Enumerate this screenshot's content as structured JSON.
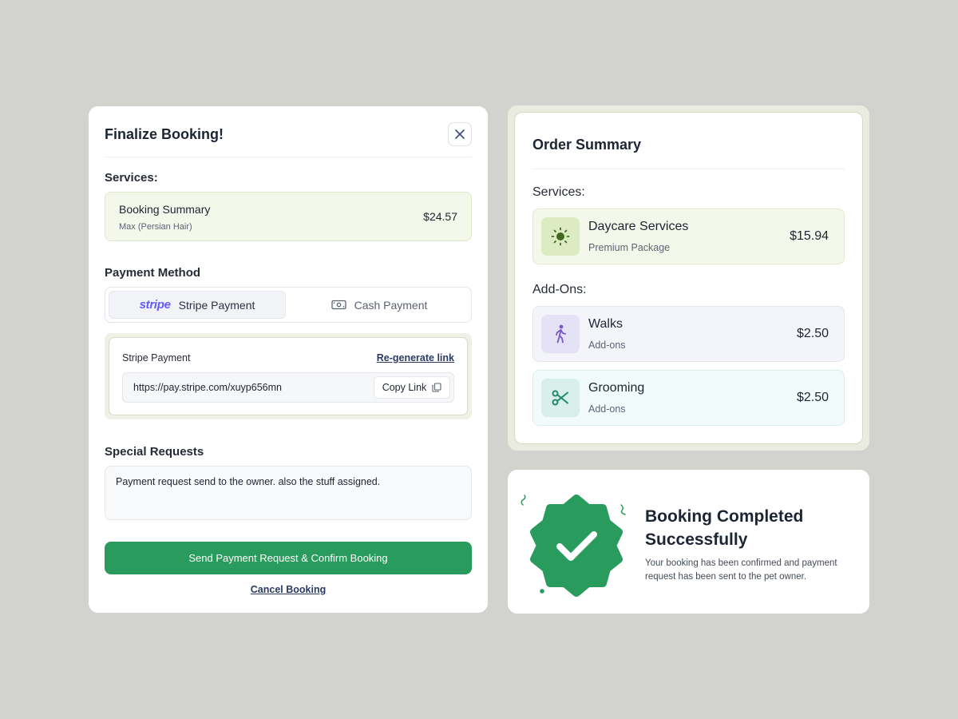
{
  "booking": {
    "title": "Finalize Booking!",
    "services_label": "Services:",
    "service": {
      "name": "Booking Summary",
      "detail": "Max (Persian Hair)",
      "price": "$24.57"
    },
    "payment_method_label": "Payment Method",
    "tabs": {
      "stripe_logo": "stripe",
      "stripe": "Stripe Payment",
      "cash": "Cash Payment"
    },
    "stripe_panel": {
      "title": "Stripe Payment",
      "regenerate": "Re-generate link",
      "url": "https://pay.stripe.com/xuyp656mn",
      "copy": "Copy Link"
    },
    "special_requests_label": "Special Requests",
    "special_requests_value": "Payment request send to the owner. also the stuff assigned.",
    "confirm_button": "Send Payment Request & Confirm Booking",
    "cancel_link": "Cancel Booking"
  },
  "order_summary": {
    "title": "Order Summary",
    "services_label": "Services:",
    "addons_label": "Add-Ons:",
    "items": [
      {
        "name": "Daycare Services",
        "sub": "Premium Package",
        "price": "$15.94",
        "icon": "sun-icon"
      },
      {
        "name": "Walks",
        "sub": "Add-ons",
        "price": "$2.50",
        "icon": "walking-person-icon"
      },
      {
        "name": "Grooming",
        "sub": "Add-ons",
        "price": "$2.50",
        "icon": "scissors-icon"
      }
    ]
  },
  "completed": {
    "title": "Booking Completed Successfully",
    "description": "Your booking has been confirmed and payment request has been sent to the pet owner."
  },
  "colors": {
    "accent_green": "#289b5d",
    "stripe_purple": "#635bff",
    "service_bg": "#f4f8ea",
    "page_bg": "#d2d2cf"
  }
}
